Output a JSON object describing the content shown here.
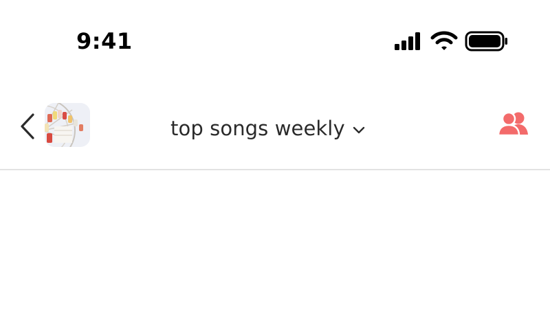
{
  "status_bar": {
    "time": "9:41"
  },
  "header": {
    "title": "top songs weekly",
    "back_icon": "chevron-left-icon",
    "dropdown_icon": "chevron-down-icon",
    "members_icon": "people-icon"
  },
  "colors": {
    "accent": "#f36b6b",
    "title_text": "#2a2a2a",
    "divider": "#e2e2e2"
  }
}
